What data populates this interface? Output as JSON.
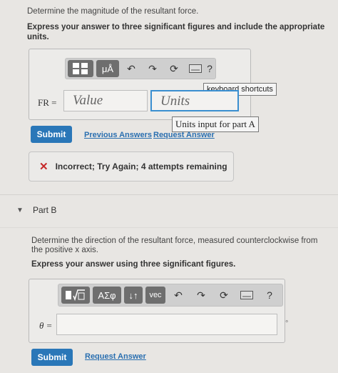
{
  "part_a": {
    "question": "Determine the magnitude of the resultant force.",
    "instruction": "Express your answer to three significant figures and include the appropriate units.",
    "toolbar": {
      "templates_icon": "templates-icon",
      "units_label": "μÅ",
      "undo_icon": "undo-icon",
      "redo_icon": "redo-icon",
      "reset_icon": "reset-icon",
      "keyboard_icon": "keyboard-icon",
      "help_label": "?"
    },
    "field_label": "FR =",
    "value_placeholder": "Value",
    "units_placeholder": "Units",
    "keyboard_tooltip": "keyboard shortcuts",
    "units_tooltip": "Units input for part A",
    "submit_label": "Submit",
    "previous_answers_label": "Previous Answers",
    "request_answer_label": "Request Answer",
    "feedback_text": "Incorrect; Try Again; 4 attempts remaining"
  },
  "part_b": {
    "title": "Part B",
    "question": "Determine the direction of the resultant force, measured counterclockwise from the positive x axis.",
    "instruction": "Express your answer using three significant figures.",
    "toolbar": {
      "templates_icon": "templates-icon",
      "greek_label": "ΑΣφ",
      "arrows_label": "↓↑",
      "vec_label": "vec",
      "undo_icon": "undo-icon",
      "redo_icon": "redo-icon",
      "reset_icon": "reset-icon",
      "keyboard_icon": "keyboard-icon",
      "help_label": "?"
    },
    "field_label": "θ =",
    "unit_suffix": "°",
    "submit_label": "Submit",
    "request_answer_label": "Request Answer"
  },
  "colors": {
    "background": "#e8e6e3",
    "submit": "#2a77b8",
    "link": "#2a6fb0",
    "error": "#c62828",
    "focus": "#3a8fd0"
  }
}
